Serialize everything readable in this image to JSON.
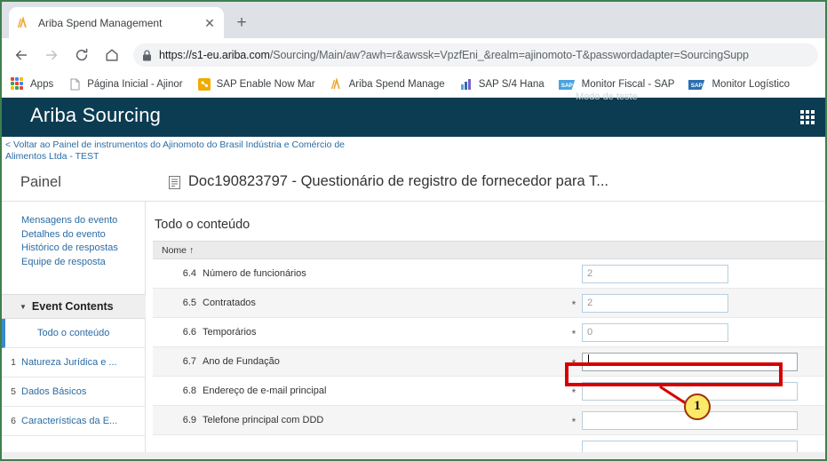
{
  "browser": {
    "tab": {
      "title": "Ariba Spend Management",
      "favicon_name": "ariba-favicon",
      "close_label": "✕"
    },
    "new_tab_label": "+",
    "nav": {
      "back_label": "←",
      "forward_label": "→",
      "reload_label": "↻",
      "home_label": "⌂"
    },
    "omnibox": {
      "lock_icon": "lock-icon",
      "url_host": "https://s1-eu.ariba.com",
      "url_path": "/Sourcing/Main/aw?awh=r&awssk=VpzfEni_&realm=ajinomoto-T&passwordadapter=SourcingSupp"
    },
    "bookmarks": [
      {
        "label": "Apps",
        "icon": "apps-grid-icon"
      },
      {
        "label": "Página Inicial - Ajinor",
        "icon": "page-icon"
      },
      {
        "label": "SAP Enable Now Mar",
        "icon": "sap-enable-now-icon"
      },
      {
        "label": "Ariba Spend Manage",
        "icon": "ariba-icon"
      },
      {
        "label": "SAP S/4 Hana",
        "icon": "sap-s4-icon"
      },
      {
        "label": "Monitor Fiscal - SAP",
        "icon": "sap-icon"
      },
      {
        "label": "Monitor Logístico",
        "icon": "sap-icon"
      }
    ]
  },
  "app": {
    "logo": "Ariba Sourcing",
    "test_mode": "Modo de teste",
    "grid_menu_icon": "app-grid-icon",
    "back_link": "< Voltar ao Painel de instrumentos do Ajinomoto do Brasil Indústria e Comércio de Alimentos Ltda - TEST",
    "panel_label": "Painel",
    "doc_icon": "document-icon",
    "doc_title": "Doc190823797 - Questionário de registro de fornecedor para T..."
  },
  "sidebar": {
    "links": [
      "Mensagens do evento",
      "Detalhes do evento",
      "Histórico de respostas",
      "Equipe de resposta"
    ],
    "section": {
      "caret": "▼",
      "title": "Event Contents"
    },
    "items": [
      {
        "num": "",
        "label": "Todo o conteúdo",
        "active": true
      },
      {
        "num": "1",
        "label": "Natureza Jurídica e ...",
        "active": false
      },
      {
        "num": "5",
        "label": "Dados Básicos",
        "active": false
      },
      {
        "num": "6",
        "label": "Características da E...",
        "active": false
      }
    ]
  },
  "main": {
    "heading": "Todo o conteúdo",
    "table": {
      "column_header_name": "Nome",
      "sort_arrow": "↑",
      "rows": [
        {
          "num": "6.4",
          "label": "Número de funcionários",
          "required": false,
          "value": "2",
          "alt": false,
          "highlighted": false
        },
        {
          "num": "6.5",
          "label": "Contratados",
          "required": true,
          "value": "2",
          "alt": true,
          "highlighted": false
        },
        {
          "num": "6.6",
          "label": "Temporários",
          "required": true,
          "value": "0",
          "alt": false,
          "highlighted": false
        },
        {
          "num": "6.7",
          "label": "Ano de Fundação",
          "required": true,
          "value": "",
          "alt": true,
          "highlighted": true
        },
        {
          "num": "6.8",
          "label": "Endereço de e-mail principal",
          "required": true,
          "value": "",
          "alt": false,
          "highlighted": false
        },
        {
          "num": "6.9",
          "label": "Telefone principal com DDD",
          "required": true,
          "value": "",
          "alt": true,
          "highlighted": false
        }
      ]
    }
  },
  "annotation": {
    "callout_number": "1",
    "callout_color": "#fbe96a",
    "highlight_color": "#d60000"
  }
}
